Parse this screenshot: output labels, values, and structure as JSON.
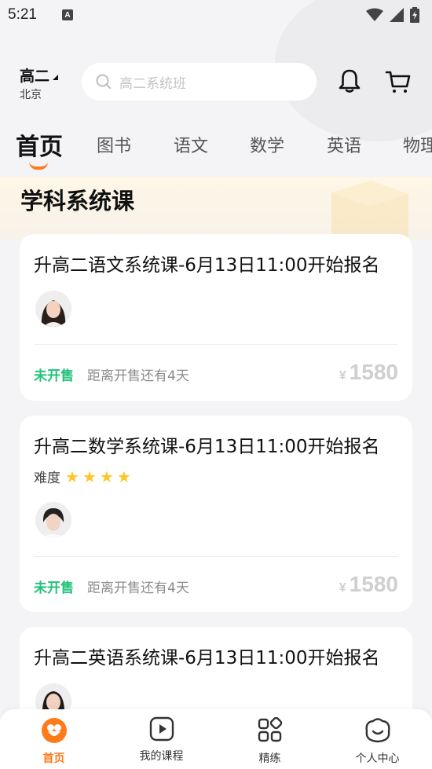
{
  "status_bar": {
    "time": "5:21",
    "notification_icon": "A"
  },
  "header": {
    "grade": "高二",
    "city": "北京",
    "search_placeholder": "高二系统班"
  },
  "tabs": [
    {
      "label": "首页",
      "active": true
    },
    {
      "label": "图书",
      "active": false
    },
    {
      "label": "语文",
      "active": false
    },
    {
      "label": "数学",
      "active": false
    },
    {
      "label": "英语",
      "active": false
    },
    {
      "label": "物理",
      "active": false
    }
  ],
  "section": {
    "title": "学科系统课"
  },
  "courses": [
    {
      "title": "升高二语文系统课-6月13日11:00开始报名",
      "sale_status": "未开售",
      "sale_note": "距离开售还有4天",
      "currency": "¥",
      "price": "1580"
    },
    {
      "title": "升高二数学系统课-6月13日11:00开始报名",
      "difficulty_label": "难度",
      "difficulty_stars": 4,
      "sale_status": "未开售",
      "sale_note": "距离开售还有4天",
      "currency": "¥",
      "price": "1580"
    },
    {
      "title": "升高二英语系统课-6月13日11:00开始报名"
    }
  ],
  "bottom_nav": [
    {
      "label": "首页",
      "icon": "home-icon",
      "active": true
    },
    {
      "label": "我的课程",
      "icon": "play-icon",
      "active": false
    },
    {
      "label": "精练",
      "icon": "grid-icon",
      "active": false
    },
    {
      "label": "个人中心",
      "icon": "profile-face-icon",
      "active": false
    }
  ],
  "colors": {
    "accent": "#ff7a1a",
    "sale_status": "#21c27a",
    "star": "#ffc629"
  }
}
